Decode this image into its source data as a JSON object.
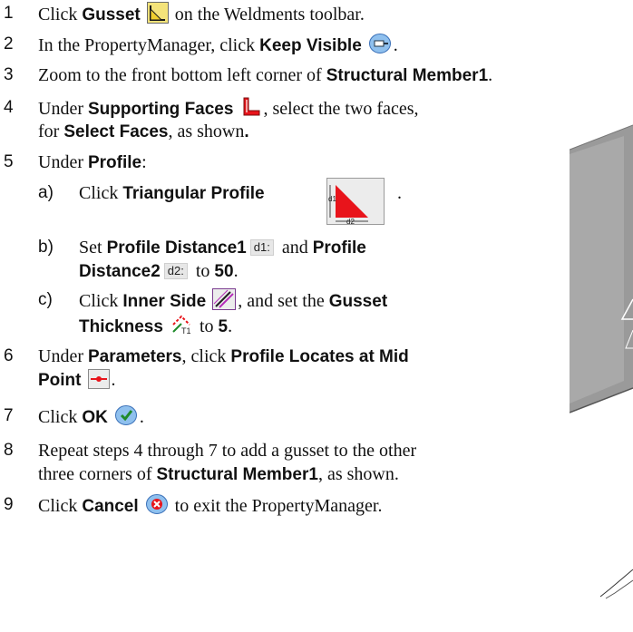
{
  "steps": [
    {
      "num": "1",
      "t1": "Click ",
      "b1": "Gusset",
      "t2": " on the Weldments toolbar.",
      "icon": "gusset-icon"
    },
    {
      "num": "2",
      "t1": "In the PropertyManager, click ",
      "b1": "Keep Visible",
      "t2": ".",
      "icon": "pushpin-icon"
    },
    {
      "num": "3",
      "t1": "Zoom to the front bottom left corner of ",
      "b1": "Structural Member1",
      "t2": "."
    },
    {
      "num": "4",
      "t1": "Under ",
      "b1": "Supporting Faces",
      "t2": ", select the two faces,",
      "line2_t1": "for ",
      "line2_b1": "Select Faces",
      "line2_t2": ", as shown",
      "line2_b2": ".",
      "icon": "supporting-faces-icon"
    },
    {
      "num": "5",
      "t1": "Under ",
      "b1": "Profile",
      "t2": ":"
    },
    {
      "num": "6",
      "t1": "Under ",
      "b1": "Parameters",
      "t2": ", click ",
      "b2": "Profile Locates at Mid",
      "line2_b1": "Point",
      "line2_t2": ".",
      "icon": "mid-point-icon"
    },
    {
      "num": "7",
      "t1": "Click ",
      "b1": "OK",
      "t2": ".",
      "icon": "ok-icon"
    },
    {
      "num": "8",
      "t1": "Repeat steps 4 through 7 to add a gusset to the other",
      "line2_t1": "three corners of ",
      "line2_b1": "Structural Member1",
      "line2_t2": ", as shown."
    },
    {
      "num": "9",
      "t1": "Click ",
      "b1": "Cancel",
      "t2": " to exit the PropertyManager.",
      "icon": "cancel-icon"
    }
  ],
  "substeps": [
    {
      "letter": "a)",
      "t1": "Click ",
      "b1": "Triangular Profile",
      "t2": ".",
      "icon": "triangular-profile-icon",
      "icon_labels": {
        "d1": "d1",
        "d2": "d2"
      }
    },
    {
      "letter": "b)",
      "t1": "Set ",
      "b1": "Profile Distance1",
      "tag1": "d1:",
      "t2": " and ",
      "b2": "Profile",
      "line2_b1": "Distance2",
      "tag2": "d2:",
      "line2_t1": " to ",
      "line2_b2": "50",
      "line2_t2": "."
    },
    {
      "letter": "c)",
      "t1": "Click ",
      "b1": "Inner Side",
      "t2": ", and set the ",
      "b2": "Gusset",
      "line2_b1": "Thickness",
      "line2_t1": " to ",
      "line2_b2": "5",
      "line2_t2": ".",
      "icon": "inner-side-icon",
      "icon2": "thickness-icon",
      "icon2_label": "T1"
    }
  ],
  "colors": {
    "accent_red": "#e8141b",
    "icon_yellow": "#f4e37a",
    "model_gray": "#9a9a9a"
  }
}
